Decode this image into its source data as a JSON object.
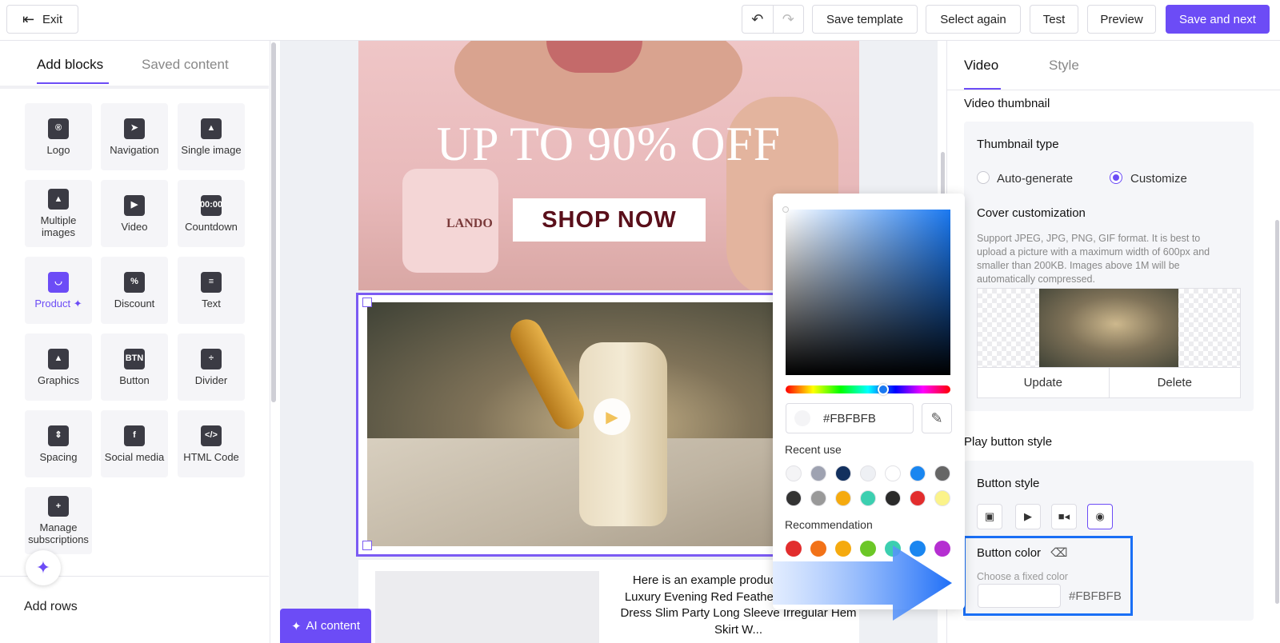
{
  "topbar": {
    "exit_label": "Exit",
    "undo_icon": "undo-icon",
    "redo_icon": "redo-icon",
    "save_template": "Save template",
    "select_again": "Select again",
    "test": "Test",
    "preview": "Preview",
    "save_next": "Save and next"
  },
  "left": {
    "tabs": [
      {
        "label": "Add blocks"
      },
      {
        "label": "Saved content"
      }
    ],
    "blocks": [
      {
        "label": "Logo",
        "icon": "logo-icon",
        "glyph": "®"
      },
      {
        "label": "Navigation",
        "icon": "navigation-icon",
        "glyph": "➤"
      },
      {
        "label": "Single image",
        "icon": "image-icon",
        "glyph": "▲"
      },
      {
        "label": "Multiple images",
        "icon": "images-icon",
        "glyph": "▲"
      },
      {
        "label": "Video",
        "icon": "video-icon",
        "glyph": "▶"
      },
      {
        "label": "Countdown",
        "icon": "countdown-icon",
        "glyph": "00:00"
      },
      {
        "label": "Product ✦",
        "icon": "product-bag-icon",
        "glyph": "◡"
      },
      {
        "label": "Discount",
        "icon": "discount-tag-icon",
        "glyph": "%"
      },
      {
        "label": "Text",
        "icon": "text-icon",
        "glyph": "≡"
      },
      {
        "label": "Graphics",
        "icon": "graphics-icon",
        "glyph": "▲"
      },
      {
        "label": "Button",
        "icon": "button-icon",
        "glyph": "BTN"
      },
      {
        "label": "Divider",
        "icon": "divider-icon",
        "glyph": "÷"
      },
      {
        "label": "Spacing",
        "icon": "spacing-icon",
        "glyph": "⇕"
      },
      {
        "label": "Social media",
        "icon": "social-media-icon",
        "glyph": "f"
      },
      {
        "label": "HTML Code",
        "icon": "html-code-icon",
        "glyph": "</>"
      },
      {
        "label": "Manage subscriptions",
        "icon": "subscriptions-icon",
        "glyph": "+"
      }
    ],
    "add_rows": "Add rows",
    "ai_content": "AI content"
  },
  "canvas": {
    "hero_title": "UP TO 90% OFF",
    "shop_now": "SHOP NOW",
    "jar_label": "LANDO",
    "product_text": "Here is an example product Sexy Dress Luxury Evening Red Feather Stitching Mini Dress Slim Party Long Sleeve Irregular Hem Skirt W..."
  },
  "picker": {
    "hex": "#FBFBFB",
    "recent_label": "Recent use",
    "recent": [
      "#f4f4f6",
      "#9ea2b1",
      "#12305e",
      "#eef0f4",
      "#ffffff",
      "#1a86f0",
      "#666666",
      "#333333",
      "#999999",
      "#f5aa0f",
      "#3ccfb0",
      "#2a2a2a",
      "#e22d2d",
      "#fbf38a"
    ],
    "recommend_label": "Recommendation",
    "recommend": [
      "#e22d2d",
      "#f27218",
      "#f5aa0f",
      "#6cc727",
      "#3ccfb0",
      "#1a86f0",
      "#b52fd1"
    ]
  },
  "right": {
    "tabs": [
      {
        "label": "Video"
      },
      {
        "label": "Style"
      }
    ],
    "video_thumbnail": "Video thumbnail",
    "thumbnail_type": "Thumbnail type",
    "auto_generate": "Auto-generate",
    "customize": "Customize",
    "cover_title": "Cover customization",
    "cover_help": "Support JPEG, JPG, PNG, GIF format. It is best to upload a picture with a maximum width of 600px and smaller than 200KB. Images above 1M will be automatically compressed.",
    "update": "Update",
    "delete": "Delete",
    "play_button_style": "Play button style",
    "button_style": "Button style",
    "style_icons": [
      "youtube-play-icon",
      "triangle-play-icon",
      "camera-icon",
      "circle-play-icon"
    ],
    "button_color": "Button color",
    "choose_color": "Choose a fixed color",
    "color_value": "#FBFBFB",
    "accent": "#6c4cf6"
  }
}
